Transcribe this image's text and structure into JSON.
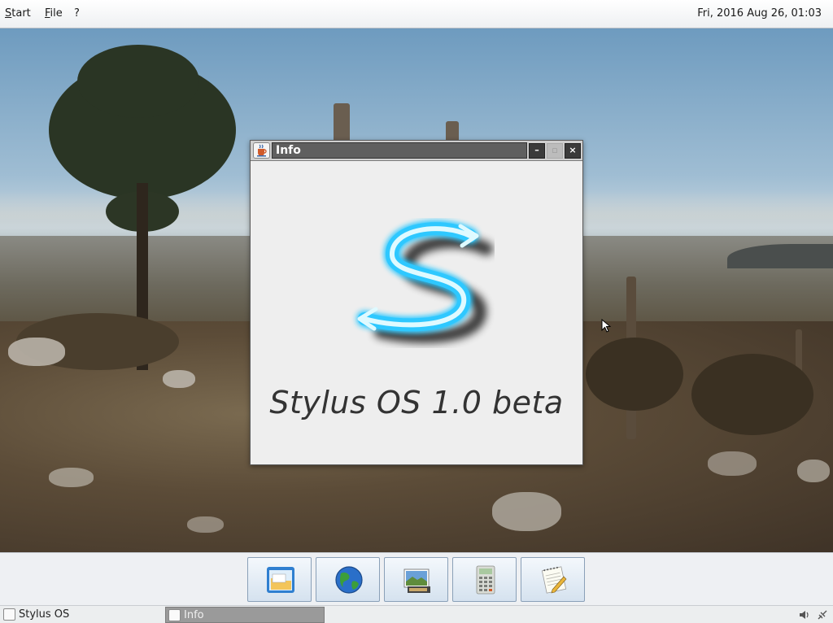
{
  "menubar": {
    "items": [
      {
        "label": "Start",
        "mnemonic": "S"
      },
      {
        "label": "File",
        "mnemonic": "F"
      },
      {
        "label": "?"
      }
    ],
    "clock": "Fri, 2016 Aug 26, 01:03"
  },
  "window": {
    "title": "Info",
    "buttons": {
      "minimize": "–",
      "maximize": "▫",
      "close": "×"
    },
    "version_text": "Stylus OS 1.0 beta",
    "logo_icon": "stylus-s-logo-icon"
  },
  "dock": {
    "apps": [
      {
        "name": "file-manager",
        "icon": "folder-icon"
      },
      {
        "name": "web-browser",
        "icon": "globe-icon"
      },
      {
        "name": "image-viewer",
        "icon": "photo-icon"
      },
      {
        "name": "calculator",
        "icon": "calculator-icon"
      },
      {
        "name": "text-editor",
        "icon": "notepad-icon"
      }
    ]
  },
  "taskbar": {
    "tasks": [
      {
        "label": "Stylus OS",
        "active": false
      },
      {
        "label": "Info",
        "active": true
      }
    ],
    "tray": [
      "volume-icon",
      "network-icon"
    ]
  },
  "colors": {
    "titlebar_field": "#5f5f5f",
    "window_bg": "#eeeeee",
    "logo_glow": "#3fd0ff"
  }
}
